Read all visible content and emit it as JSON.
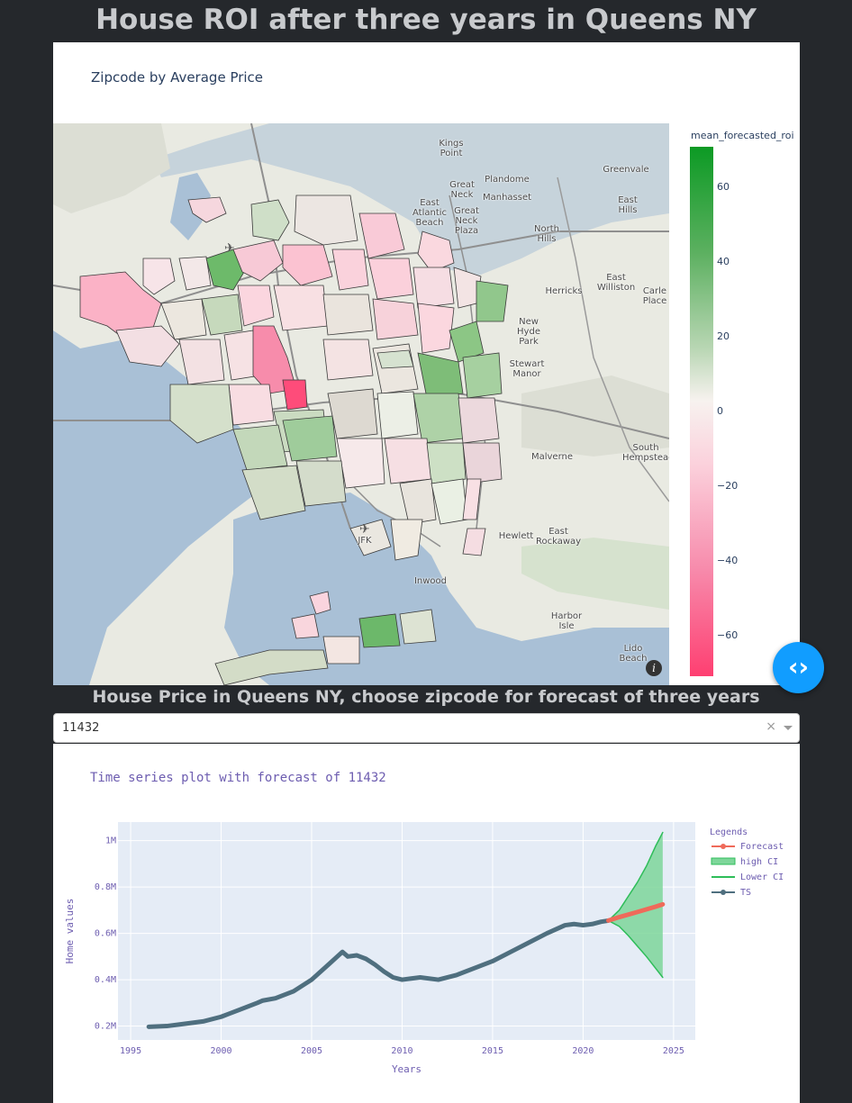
{
  "page": {
    "title": "House ROI after three years in Queens NY",
    "subtitle": "House Price in Queens NY, choose zipcode for forecast of three years"
  },
  "map_card": {
    "title": "Zipcode by Average Price",
    "colorbar_title": "mean_forecasted_roi",
    "colorbar_ticks": [
      "60",
      "40",
      "20",
      "0",
      "−20",
      "−40",
      "−60"
    ],
    "colorbar_colors": {
      "high": "#0c9a24",
      "mid": "#f7f2ef",
      "low": "#fe3f71"
    },
    "info_icon": "info-icon",
    "place_labels": [
      "Kings Point",
      "Plandome",
      "Great Neck",
      "Manhasset",
      "Great Neck Plaza",
      "East Atlantic Beach",
      "Greenvale",
      "East Hills",
      "North Hills",
      "Herricks",
      "East Williston",
      "Carle Place",
      "New Hyde Park",
      "Stewart Manor",
      "Malverne",
      "South Hempstead",
      "Hewlett",
      "East Rockaway",
      "Inwood",
      "Harbor Isle",
      "Lido Beach",
      "JFK"
    ]
  },
  "toggle_button": {
    "icon": "code-toggle-icon",
    "glyph": "‹›"
  },
  "dropdown": {
    "selected": "11432",
    "clear_glyph": "×"
  },
  "ts_card": {
    "title": "Time series plot with forecast of 11432",
    "xlabel": "Years",
    "ylabel": "Home values",
    "legend_title": "Legends",
    "legend_items": [
      "Forecast",
      "high CI",
      "Lower CI",
      "TS"
    ],
    "colors": {
      "ts": "#4f6f7f",
      "forecast": "#ef6a5a",
      "ci": "#2ebd59",
      "ci_fill": "#7ed69a"
    }
  },
  "chart_data": {
    "type": "line",
    "title": "Time series plot with forecast of 11432",
    "xlabel": "Years",
    "ylabel": "Home values",
    "xlim": [
      1994.3,
      2026.2
    ],
    "ylim": [
      140000,
      1080000
    ],
    "x_ticks": [
      "1995",
      "2000",
      "2005",
      "2010",
      "2015",
      "2020",
      "2025"
    ],
    "y_ticks": [
      "0.2M",
      "0.4M",
      "0.6M",
      "0.8M",
      "1M"
    ],
    "legend_position": "right",
    "grid": true,
    "series": [
      {
        "name": "TS",
        "x": [
          1996.0,
          1997.0,
          1998.0,
          1999.0,
          2000.0,
          2001.0,
          2002.0,
          2002.3,
          2003.0,
          2004.0,
          2005.0,
          2006.0,
          2006.7,
          2007.0,
          2007.5,
          2008.0,
          2008.5,
          2009.0,
          2009.5,
          2010.0,
          2010.5,
          2011.0,
          2012.0,
          2013.0,
          2014.0,
          2015.0,
          2016.0,
          2017.0,
          2018.0,
          2019.0,
          2019.5,
          2020.0,
          2020.5,
          2021.0,
          2021.4
        ],
        "y": [
          197000,
          200000,
          210000,
          220000,
          240000,
          270000,
          300000,
          310000,
          320000,
          350000,
          400000,
          470000,
          520000,
          500000,
          505000,
          490000,
          465000,
          435000,
          410000,
          400000,
          405000,
          410000,
          400000,
          420000,
          450000,
          480000,
          520000,
          560000,
          600000,
          635000,
          640000,
          635000,
          640000,
          650000,
          655000
        ]
      },
      {
        "name": "Forecast",
        "x": [
          2021.4,
          2022.0,
          2023.0,
          2024.0,
          2024.4
        ],
        "y": [
          655000,
          670000,
          692000,
          715000,
          725000
        ]
      },
      {
        "name": "high CI",
        "x": [
          2021.4,
          2022.0,
          2022.5,
          2023.0,
          2023.5,
          2024.0,
          2024.4
        ],
        "y": [
          655000,
          700000,
          760000,
          820000,
          890000,
          975000,
          1035000
        ]
      },
      {
        "name": "Lower CI",
        "x": [
          2021.4,
          2022.0,
          2022.5,
          2023.0,
          2023.5,
          2024.0,
          2024.4
        ],
        "y": [
          655000,
          630000,
          590000,
          545000,
          500000,
          450000,
          410000
        ]
      }
    ]
  }
}
